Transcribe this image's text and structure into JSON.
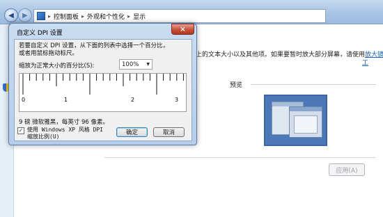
{
  "breadcrumb": [
    "控制面板",
    "外观和个性化",
    "显示"
  ],
  "background": {
    "description_part": "上的文本大小以及其他项。如果要暂时放大部分屏幕，请使用",
    "magnifier_link": "放大镜",
    "magnifier_link_tail": "工",
    "preview_label": "预览",
    "apply_button": "应用(A)"
  },
  "dialog": {
    "title": "自定义 DPI 设置",
    "close_label": "×",
    "description_line1": "若要自定义 DPI 设置，从下面的列表中选择一个百分比，",
    "description_line2": "或者用鼠标拖动标尺。",
    "scale_label": "缩放为正常大小的百分比(S):",
    "scale_value": "100%",
    "ruler_numbers": [
      "0",
      "1",
      "2",
      "3"
    ],
    "font_info": "9 磅 微软雅黑，每英寸 96 像素。",
    "xp_checkbox_checked": true,
    "xp_checkbox_label": "使用 Windows XP 风格 DPI 缩放比例(U)",
    "ok_button": "确定",
    "cancel_button": "取消"
  }
}
